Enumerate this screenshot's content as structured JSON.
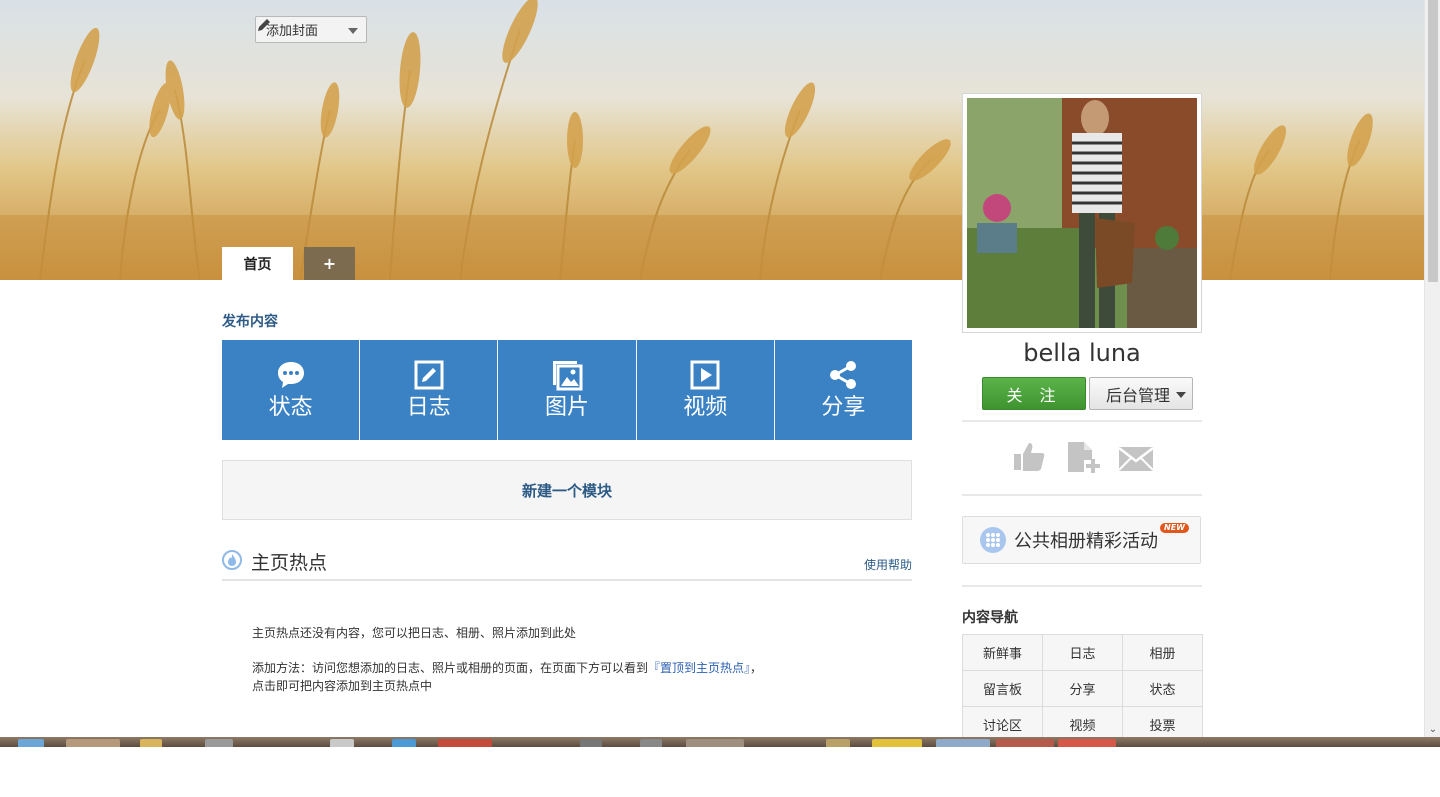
{
  "header": {
    "add_cover_label": "添加封面",
    "tabs": [
      {
        "label": "首页"
      },
      {
        "label": "+"
      }
    ]
  },
  "publish": {
    "title": "发布内容",
    "buttons": [
      {
        "label": "状态",
        "icon": "chat-bubble-icon"
      },
      {
        "label": "日志",
        "icon": "edit-note-icon"
      },
      {
        "label": "图片",
        "icon": "image-icon"
      },
      {
        "label": "视频",
        "icon": "video-play-icon"
      },
      {
        "label": "分享",
        "icon": "share-icon"
      }
    ],
    "new_module_label": "新建一个模块"
  },
  "hot": {
    "title": "主页热点",
    "help_label": "使用帮助",
    "empty_text": "主页热点还没有内容，您可以把日志、相册、照片添加到此处",
    "method_prefix": "添加方法：访问您想添加的日志、照片或相册的页面，在页面下方可以看到",
    "method_link": "『置顶到主页热点』",
    "method_suffix": "，",
    "method_line2": "点击即可把内容添加到主页热点中"
  },
  "profile": {
    "username": "bella luna",
    "follow_label": "关 注",
    "admin_label": "后台管理",
    "actions": [
      "thumbs-up-icon",
      "add-page-icon",
      "mail-icon"
    ],
    "activity_label": "公共相册精彩活动",
    "activity_badge": "NEW"
  },
  "content_nav": {
    "title": "内容导航",
    "items": [
      "新鲜事",
      "日志",
      "相册",
      "留言板",
      "分享",
      "状态",
      "讨论区",
      "视频",
      "投票"
    ]
  },
  "colors": {
    "publish_blue": "#3b82c4",
    "title_blue": "#2d5b86",
    "follow_green": "#4aa23a",
    "badge_orange": "#e2571c"
  }
}
